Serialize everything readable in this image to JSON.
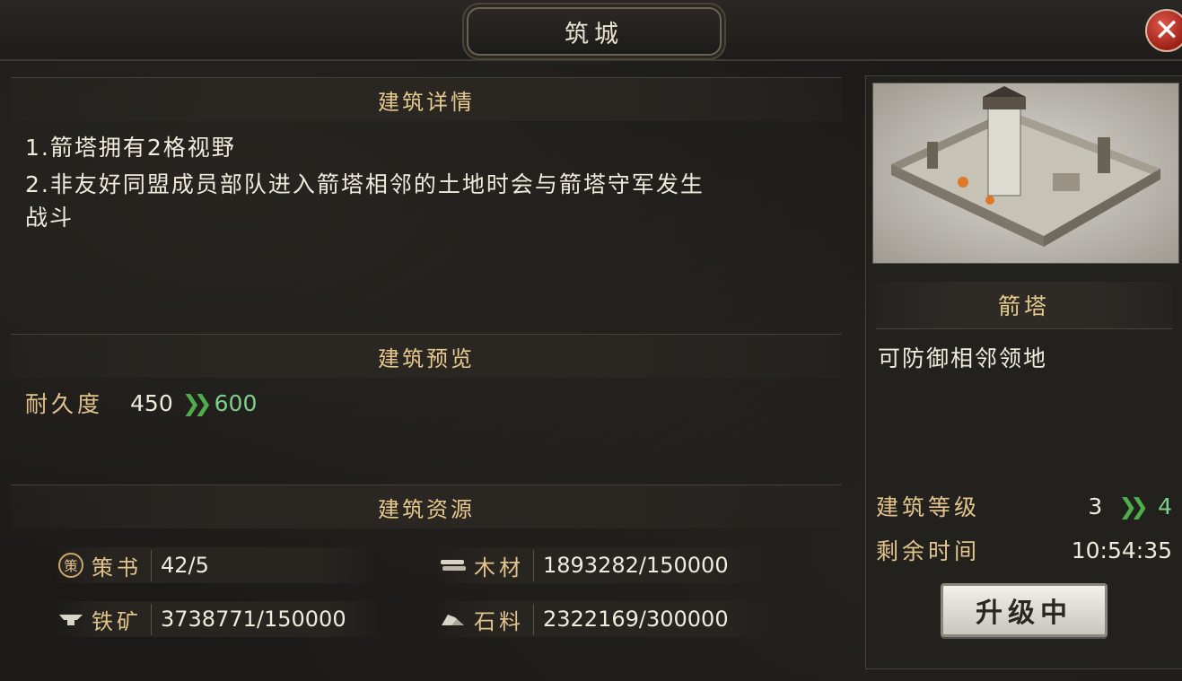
{
  "window": {
    "title": "筑城",
    "close_label": "✕"
  },
  "details": {
    "header": "建筑详情",
    "lines": [
      "1.箭塔拥有2格视野",
      "2.非友好同盟成员部队进入箭塔相邻的土地时会与箭塔守军发生",
      "战斗"
    ]
  },
  "preview": {
    "header": "建筑预览",
    "stat_label": "耐久度",
    "current": "450",
    "next": "600"
  },
  "resources": {
    "header": "建筑资源",
    "items": [
      {
        "icon": "book-icon",
        "label": "策书",
        "value": "42/5"
      },
      {
        "icon": "wood-icon",
        "label": "木材",
        "value": "1893282/150000"
      },
      {
        "icon": "iron-ore-icon",
        "label": "铁矿",
        "value": "3738771/150000"
      },
      {
        "icon": "stone-icon",
        "label": "石料",
        "value": "2322169/300000"
      }
    ]
  },
  "building": {
    "name": "箭塔",
    "description": "可防御相邻领地",
    "level_label": "建筑等级",
    "level_current": "3",
    "level_next": "4",
    "time_label": "剩余时间",
    "time_value": "10:54:35",
    "button_label": "升级中"
  },
  "colors": {
    "accent_gold": "#e2c48c",
    "next_value_green": "#7ecf8a",
    "arrow_green": "#4fae4b",
    "close_red": "#c0352a"
  }
}
